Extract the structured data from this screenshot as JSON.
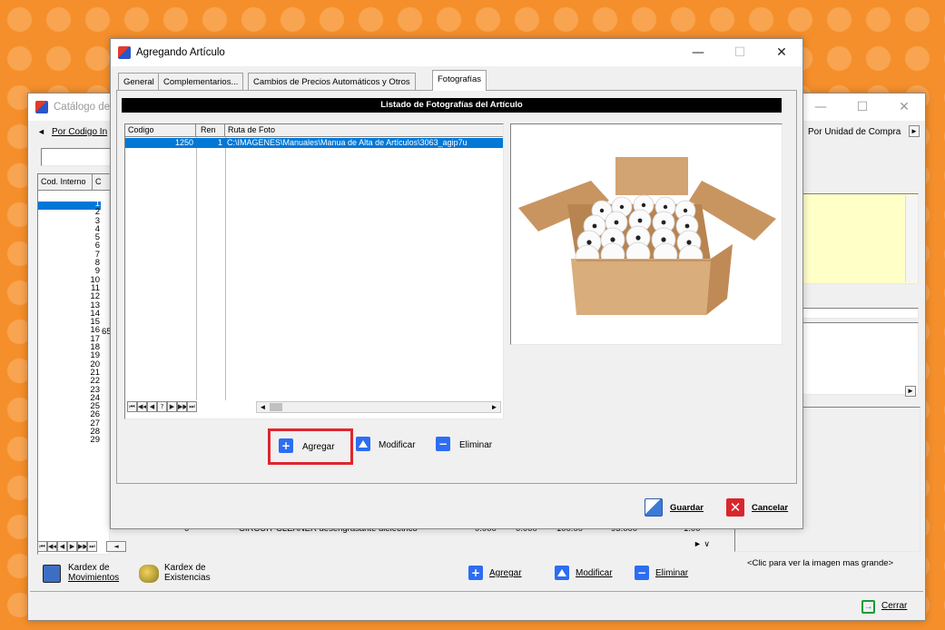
{
  "catalog_window": {
    "title": "Catálogo de",
    "left_nav_label": "Por Codigo In",
    "right_nav_label": "Por Unidad de Compra",
    "column_headers": [
      "Cod. Interno",
      "C"
    ],
    "row_numbers": [
      "1",
      "2",
      "3",
      "4",
      "5",
      "6",
      "7",
      "8",
      "9",
      "10",
      "11",
      "12",
      "13",
      "14",
      "15",
      "16",
      "17",
      "18",
      "19",
      "20",
      "21",
      "22",
      "23",
      "24",
      "25",
      "26",
      "27",
      "28",
      "29"
    ],
    "row16_extra": "65",
    "bottom_row": {
      "code_tail": "0",
      "description": "CIRCUIT CLEANER desengrasante dieléctrico",
      "values": [
        "0.000",
        "0.000",
        "100.00",
        "95.000",
        "1.00"
      ]
    },
    "kardex_movimientos": [
      "Kardex de",
      "Movimientos"
    ],
    "kardex_existencias": [
      "Kardex de",
      "Existencias"
    ],
    "buttons": {
      "agregar": "Agregar",
      "modificar": "Modificar",
      "eliminar": "Eliminar"
    },
    "image_hint": "<Clic para ver la imagen mas grande>",
    "close_button": "Cerrar"
  },
  "dialog": {
    "title": "Agregando Artículo",
    "tabs": [
      "General",
      "Complementarios...",
      "Cambios de Precios Automáticos y Otros",
      "Fotografías"
    ],
    "active_tab": "Fotografías",
    "list_title": "Listado de Fotografías del Artículo",
    "grid_headers": [
      "Codigo",
      "Ren",
      "Ruta de Foto"
    ],
    "grid_rows": [
      {
        "codigo": "1250",
        "ren": "1",
        "ruta": "C:\\IMAGENES\\Manuales\\Manua de Alta de Artículos\\3063_agip7u"
      }
    ],
    "nav_buttons": [
      "⏮",
      "◀◀",
      "◀",
      "?",
      "▶",
      "▶▶",
      "⏭"
    ],
    "photo_alt": "box-of-paper-rolls",
    "buttons": {
      "agregar": "Agregar",
      "modificar": "Modificar",
      "eliminar": "Eliminar"
    },
    "save_label": "Guardar",
    "cancel_label": "Cancelar"
  },
  "colors": {
    "background": "#f58f2b",
    "accent_blue": "#2d6df3",
    "highlight_red": "#e0252f",
    "selection": "#0078d7",
    "note_yellow": "#ffffc8"
  }
}
